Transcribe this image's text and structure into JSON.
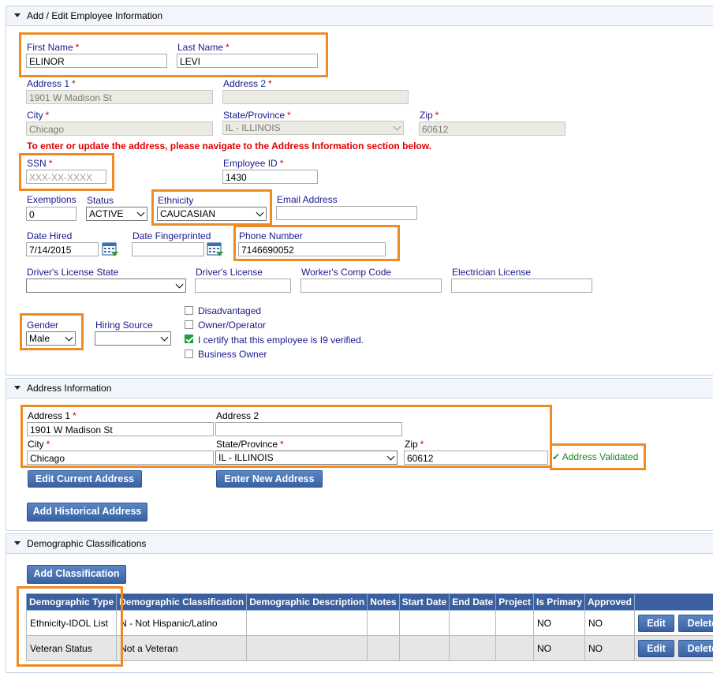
{
  "employee_section": {
    "title": "Add / Edit Employee Information",
    "first_name_label": "First Name",
    "first_name_value": "ELINOR",
    "last_name_label": "Last Name",
    "last_name_value": "LEVI",
    "address1_label": "Address 1",
    "address1_value": "1901 W Madison St",
    "address2_label": "Address 2",
    "address2_value": "",
    "city_label": "City",
    "city_value": "Chicago",
    "state_label": "State/Province",
    "state_value": "IL - ILLINOIS",
    "zip_label": "Zip",
    "zip_value": "60612",
    "address_notice": "To enter or update the address, please navigate to the Address Information section below.",
    "ssn_label": "SSN",
    "ssn_placeholder": "XXX-XX-XXXX",
    "employee_id_label": "Employee ID",
    "employee_id_value": "1430",
    "exemptions_label": "Exemptions",
    "exemptions_value": "0",
    "status_label": "Status",
    "status_value": "ACTIVE",
    "ethnicity_label": "Ethnicity",
    "ethnicity_value": "CAUCASIAN",
    "email_label": "Email Address",
    "email_value": "",
    "date_hired_label": "Date Hired",
    "date_hired_value": "7/14/2015",
    "date_fingerprinted_label": "Date Fingerprinted",
    "date_fingerprinted_value": "",
    "phone_label": "Phone Number",
    "phone_value": "7146690052",
    "dl_state_label": "Driver's License State",
    "dl_label": "Driver's License",
    "workers_comp_label": "Worker's Comp Code",
    "electrician_label": "Electrician License",
    "gender_label": "Gender",
    "gender_value": "Male",
    "hiring_source_label": "Hiring Source",
    "checkboxes": [
      {
        "label": "Disadvantaged",
        "checked": false
      },
      {
        "label": "Owner/Operator",
        "checked": false
      },
      {
        "label": "I certify that this employee is I9 verified.",
        "checked": true
      },
      {
        "label": "Business Owner",
        "checked": false
      }
    ]
  },
  "address_section": {
    "title": "Address Information",
    "address1_label": "Address 1",
    "address1_value": "1901 W Madison St",
    "address2_label": "Address 2",
    "address2_value": "",
    "city_label": "City",
    "city_value": "Chicago",
    "state_label": "State/Province",
    "state_value": "IL - ILLINOIS",
    "zip_label": "Zip",
    "zip_value": "60612",
    "validated_text": "Address Validated",
    "edit_button": "Edit Current Address",
    "new_button": "Enter New Address",
    "historical_button": "Add Historical Address"
  },
  "demographic_section": {
    "title": "Demographic Classifications",
    "add_button": "Add Classification",
    "columns": [
      "Demographic Type",
      "Demographic Classification",
      "Demographic Description",
      "Notes",
      "Start Date",
      "End Date",
      "Project",
      "Is Primary",
      "Approved",
      ""
    ],
    "rows": [
      {
        "type": "Ethnicity-IDOL List",
        "classification": "N - Not Hispanic/Latino",
        "description": "",
        "notes": "",
        "start": "",
        "end": "",
        "project": "",
        "primary": "NO",
        "approved": "NO"
      },
      {
        "type": "Veteran Status",
        "classification": "Not a Veteran",
        "description": "",
        "notes": "",
        "start": "",
        "end": "",
        "project": "",
        "primary": "NO",
        "approved": "NO"
      }
    ],
    "edit_label": "Edit",
    "delete_label": "Delete"
  },
  "required_mark": "*",
  "colors": {
    "highlight": "#f08a24",
    "label": "#1a1a8c",
    "required": "#d40000",
    "button": "#3a62a3",
    "header": "#3c5fa0"
  }
}
